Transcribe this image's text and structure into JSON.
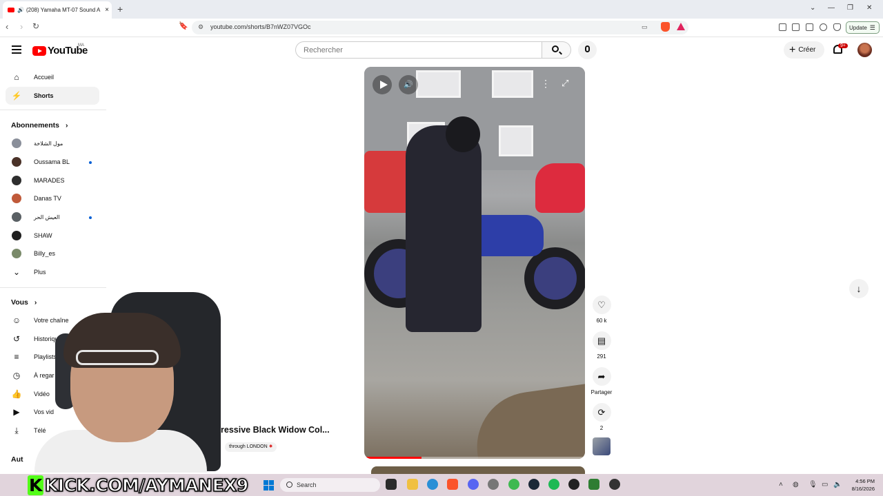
{
  "browser": {
    "tab_title": "(208) Yamaha MT-07 Sound A",
    "tab_close": "×",
    "new_tab": "+",
    "url": "youtube.com/shorts/B7nWZ07VGOc",
    "update_label": "Update"
  },
  "header": {
    "logo_text": "YouTube",
    "country_code": "MA",
    "search_placeholder": "Rechercher",
    "create_label": "Créer",
    "notif_badge": "9+"
  },
  "sidebar": {
    "main": [
      {
        "label": "Accueil",
        "icon": "home-icon"
      },
      {
        "label": "Shorts",
        "icon": "shorts-icon",
        "active": true
      }
    ],
    "subs_title": "Abonnements",
    "subscriptions": [
      {
        "label": "مول الشلاخة",
        "color": "#8a8f9a",
        "dot": false
      },
      {
        "label": "Oussama BL",
        "color": "#4a3228",
        "dot": true
      },
      {
        "label": "MARADES",
        "color": "#2e2e2e",
        "dot": false
      },
      {
        "label": "Danas TV",
        "color": "#c05a3a",
        "dot": false
      },
      {
        "label": "العيش الحر",
        "color": "#5a6064",
        "dot": true
      },
      {
        "label": "SHAW",
        "color": "#1f1f1f",
        "dot": false
      },
      {
        "label": "Billy_es",
        "color": "#7a8a6a",
        "dot": false
      }
    ],
    "more_label": "Plus",
    "you_title": "Vous",
    "you_items": [
      {
        "label": "Votre chaîne",
        "icon": "channel-icon"
      },
      {
        "label": "Historique",
        "icon": "history-icon"
      },
      {
        "label": "Playlists",
        "icon": "playlist-icon"
      },
      {
        "label": "À regar",
        "icon": "watch-later-icon"
      },
      {
        "label": "Vidéo",
        "icon": "liked-icon"
      },
      {
        "label": "Vos vid",
        "icon": "your-videos-icon"
      },
      {
        "label": "Télé",
        "icon": "download-icon"
      }
    ],
    "bottom_label": "Aut"
  },
  "short": {
    "title": "ressive Black Widow Col...",
    "channel_tag": "through LONDON",
    "progress": 0.26
  },
  "actions": {
    "likes": "60 k",
    "comments": "291",
    "share": "Partager",
    "remix": "2"
  },
  "overlay": {
    "kick_logo": "K",
    "kick_text": "KICK.COM/AYMANEX9"
  },
  "taskbar": {
    "search": "Search",
    "time": "4:56 PM",
    "date": "8/16/2026"
  }
}
